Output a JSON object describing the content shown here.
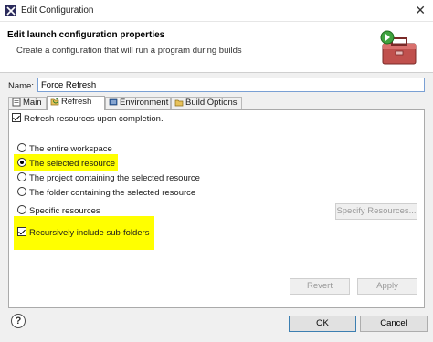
{
  "window": {
    "title": "Edit Configuration"
  },
  "header": {
    "title": "Edit launch configuration properties",
    "description": "Create a configuration that will run a program during builds"
  },
  "name_field": {
    "label": "Name:",
    "value": "Force Refresh"
  },
  "tabs": [
    {
      "label": "Main",
      "icon": "main-tab-icon"
    },
    {
      "label": "Refresh",
      "icon": "refresh-tab-icon",
      "active": true
    },
    {
      "label": "Environment",
      "icon": "environment-tab-icon"
    },
    {
      "label": "Build Options",
      "icon": "build-options-tab-icon"
    }
  ],
  "refresh_panel": {
    "refresh_upon_completion": {
      "label": "Refresh resources upon completion.",
      "checked": true
    },
    "options": [
      {
        "label": "The entire workspace",
        "selected": false
      },
      {
        "label": "The selected resource",
        "selected": true
      },
      {
        "label": "The project containing the selected resource",
        "selected": false
      },
      {
        "label": "The folder containing the selected resource",
        "selected": false
      },
      {
        "label": "Specific resources",
        "selected": false
      }
    ],
    "specify_resources_label": "Specify Resources...",
    "recursive": {
      "label": "Recursively include sub-folders",
      "checked": true
    },
    "highlight_color": "#ffff00"
  },
  "panel_buttons": {
    "revert": "Revert",
    "apply": "Apply"
  },
  "dialog_buttons": {
    "ok": "OK",
    "cancel": "Cancel",
    "help": "?"
  }
}
